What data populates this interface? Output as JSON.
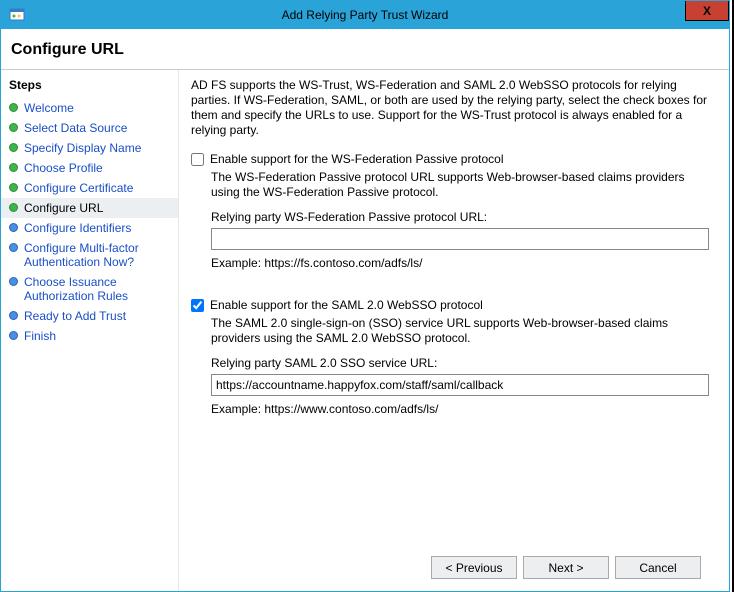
{
  "window": {
    "title": "Add Relying Party Trust Wizard",
    "close": "X"
  },
  "header": "Configure URL",
  "steps_title": "Steps",
  "steps": [
    {
      "label": "Welcome",
      "state": "done"
    },
    {
      "label": "Select Data Source",
      "state": "done"
    },
    {
      "label": "Specify Display Name",
      "state": "done"
    },
    {
      "label": "Choose Profile",
      "state": "done"
    },
    {
      "label": "Configure Certificate",
      "state": "done"
    },
    {
      "label": "Configure URL",
      "state": "done",
      "current": true
    },
    {
      "label": "Configure Identifiers",
      "state": "todo"
    },
    {
      "label": "Configure Multi-factor Authentication Now?",
      "state": "todo"
    },
    {
      "label": "Choose Issuance Authorization Rules",
      "state": "todo"
    },
    {
      "label": "Ready to Add Trust",
      "state": "todo"
    },
    {
      "label": "Finish",
      "state": "todo"
    }
  ],
  "content": {
    "intro": "AD FS supports the WS-Trust, WS-Federation and SAML 2.0 WebSSO protocols for relying parties.  If WS-Federation, SAML, or both are used by the relying party, select the check boxes for them and specify the URLs to use.  Support for the WS-Trust protocol is always enabled for a relying party.",
    "wsfed": {
      "checkbox_label": "Enable support for the WS-Federation Passive protocol",
      "checked": false,
      "description": "The WS-Federation Passive protocol URL supports Web-browser-based claims providers using the WS-Federation Passive protocol.",
      "url_label": "Relying party WS-Federation Passive protocol URL:",
      "url_value": "",
      "example": "Example: https://fs.contoso.com/adfs/ls/"
    },
    "saml": {
      "checkbox_label": "Enable support for the SAML 2.0 WebSSO protocol",
      "checked": true,
      "description": "The SAML 2.0 single-sign-on (SSO) service URL supports Web-browser-based claims providers using the SAML 2.0 WebSSO protocol.",
      "url_label": "Relying party SAML 2.0 SSO service URL:",
      "url_value": "https://accountname.happyfox.com/staff/saml/callback",
      "example": "Example: https://www.contoso.com/adfs/ls/"
    }
  },
  "buttons": {
    "previous": "< Previous",
    "next": "Next >",
    "cancel": "Cancel"
  }
}
